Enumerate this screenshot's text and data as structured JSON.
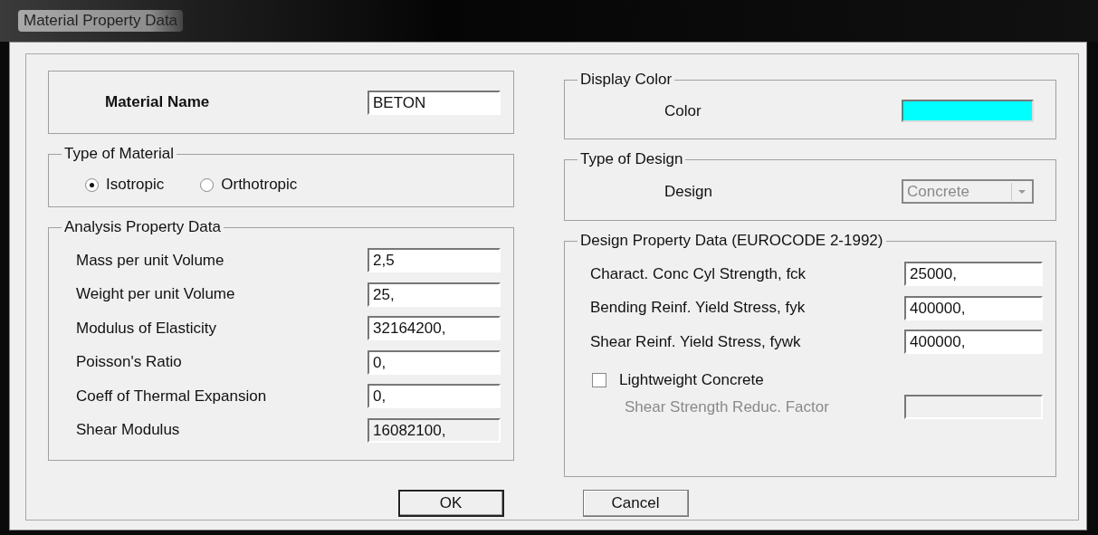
{
  "window": {
    "title": "Material Property Data"
  },
  "material_name": {
    "label": "Material Name",
    "value": "BETON"
  },
  "type_of_material": {
    "title": "Type of Material",
    "options": [
      {
        "label": "Isotropic",
        "selected": true
      },
      {
        "label": "Orthotropic",
        "selected": false
      }
    ]
  },
  "analysis_property_data": {
    "title": "Analysis Property Data",
    "fields": [
      {
        "label": "Mass per unit Volume",
        "value": "2,5",
        "disabled": false
      },
      {
        "label": "Weight per unit Volume",
        "value": "25,",
        "disabled": false
      },
      {
        "label": "Modulus of Elasticity",
        "value": "32164200,",
        "disabled": false
      },
      {
        "label": "Poisson's Ratio",
        "value": "0,",
        "disabled": false
      },
      {
        "label": "Coeff of Thermal Expansion",
        "value": "0,",
        "disabled": false
      },
      {
        "label": "Shear Modulus",
        "value": "16082100,",
        "disabled": true
      }
    ]
  },
  "display_color": {
    "title": "Display Color",
    "label": "Color",
    "color": "#00ffff"
  },
  "type_of_design": {
    "title": "Type of Design",
    "label": "Design",
    "value": "Concrete",
    "disabled": true
  },
  "design_property_data": {
    "title": "Design Property Data (EUROCODE 2-1992)",
    "fields": [
      {
        "label": "Charact. Conc Cyl Strength, fck",
        "value": "25000,"
      },
      {
        "label": "Bending Reinf. Yield Stress, fyk",
        "value": "400000,"
      },
      {
        "label": "Shear Reinf. Yield Stress, fywk",
        "value": "400000,"
      }
    ],
    "lightweight": {
      "label": "Lightweight Concrete",
      "checked": false
    },
    "reduction_factor": {
      "label": "Shear Strength Reduc. Factor",
      "disabled": true
    }
  },
  "buttons": [
    {
      "label": "OK",
      "default": true
    },
    {
      "label": "Cancel",
      "default": false
    }
  ]
}
